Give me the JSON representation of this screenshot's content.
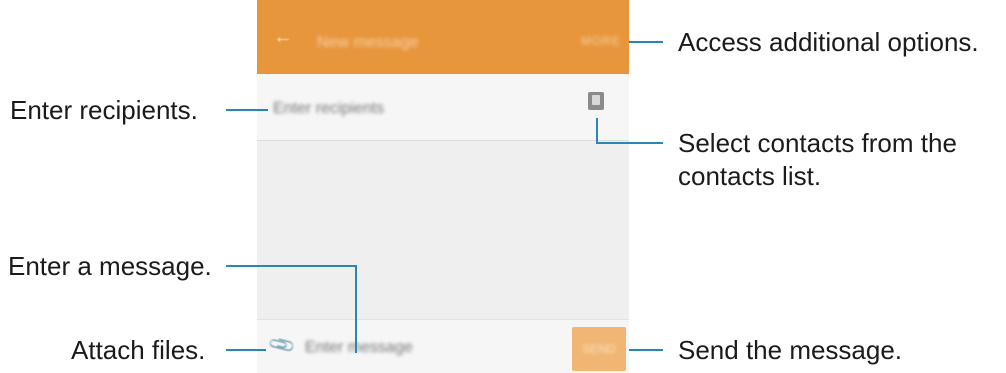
{
  "screen": {
    "app_title": "New message",
    "more_label": "MORE",
    "recipient_placeholder": "Enter recipients",
    "message_placeholder": "Enter message",
    "send_label": "SEND",
    "accent_color": "#e8963c",
    "icons": [
      "back-arrow-icon",
      "contact-picker-icon",
      "attach-icon"
    ]
  },
  "callouts": {
    "access_options": "Access additional options.",
    "enter_recipients": "Enter recipients.",
    "select_contacts_line1": "Select contacts from the",
    "select_contacts_line2": "contacts list.",
    "enter_message": "Enter a message.",
    "attach_files": "Attach files.",
    "send_message": "Send the message.",
    "line_color": "#2a86b5"
  }
}
